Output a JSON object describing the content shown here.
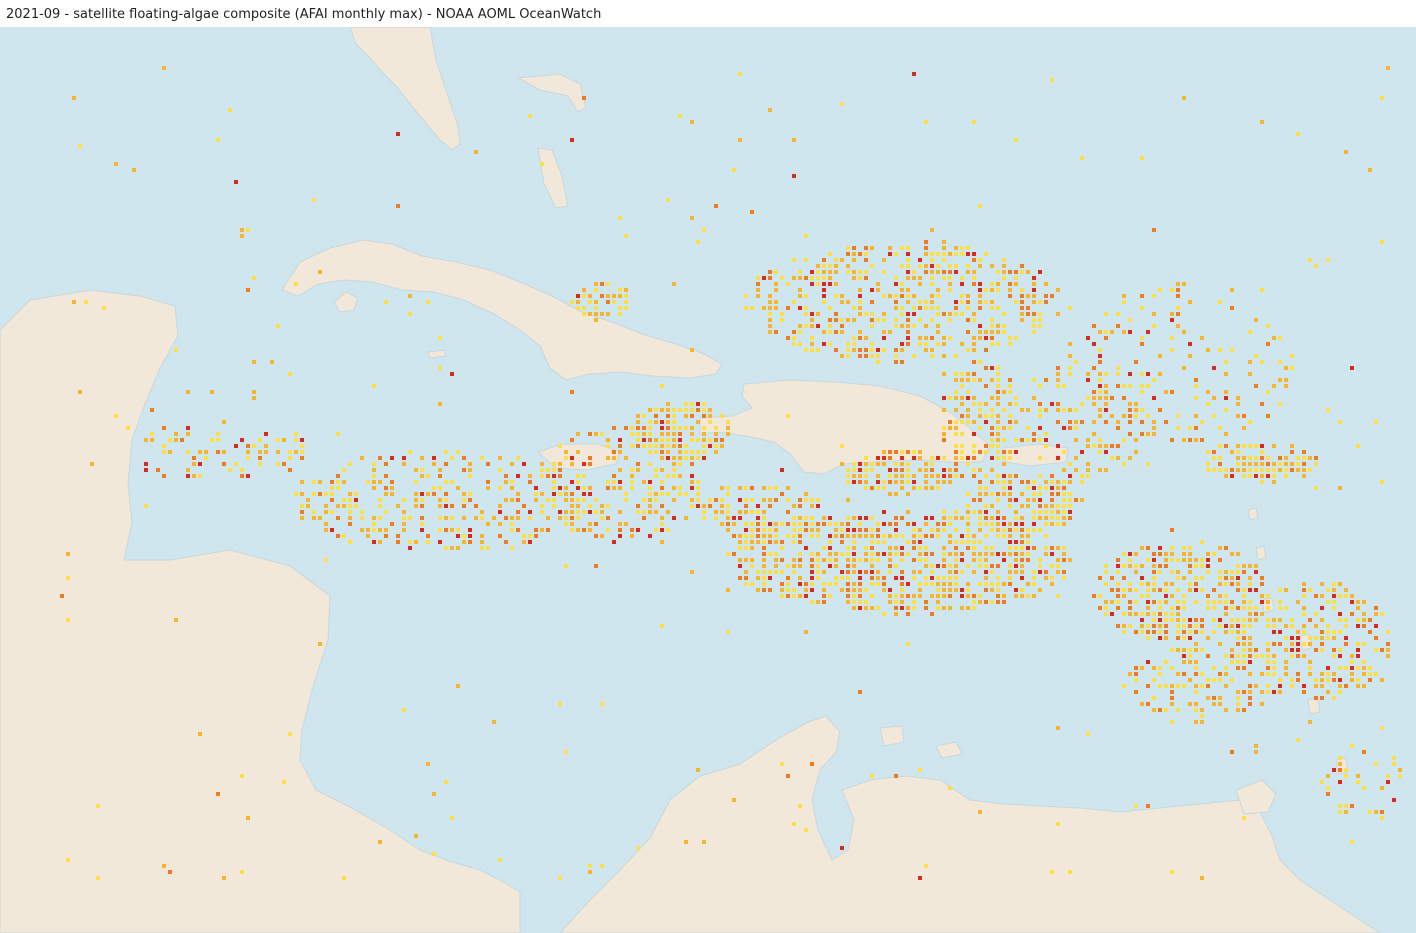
{
  "title": "2021-09 - satellite floating-algae composite (AFAI monthly max) - NOAA AOML OceanWatch",
  "map": {
    "ocean_color": "#cfe6ee",
    "land_color": "#f1e8d9",
    "coast_color": "#c9d7dc",
    "algae_ramp": [
      "#fbe04a",
      "#f7b42e",
      "#ee7b22",
      "#d62b1e"
    ]
  }
}
